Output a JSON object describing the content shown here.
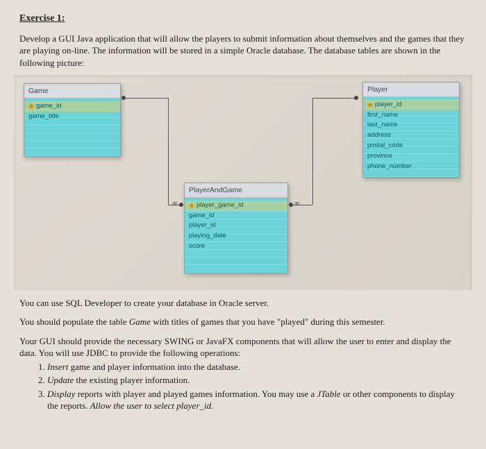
{
  "heading": "Exercise 1:",
  "intro": "Develop a GUI Java application that will allow the players to submit information about themselves and the games that they are playing on-line. The information will be stored in a simple Oracle database. The database tables are shown in the following picture:",
  "tables": {
    "game": {
      "name": "Game",
      "fields": [
        "game_id",
        "game_title"
      ]
    },
    "player": {
      "name": "Player",
      "fields": [
        "player_id",
        "first_name",
        "last_name",
        "address",
        "postal_code",
        "province",
        "phone_number"
      ]
    },
    "pag": {
      "name": "PlayerAndGame",
      "fields": [
        "player_game_id",
        "game_id",
        "player_id",
        "playing_date",
        "score"
      ]
    }
  },
  "p1": "You can use SQL Developer to create your database in Oracle server.",
  "p2_a": "You should populate the table ",
  "p2_game": "Game",
  "p2_b": " with titles of games that you have \"played\" during this semester.",
  "p3": "Your GUI should provide the necessary SWING or JavaFX components that will allow the user to enter and display the data. You will use JDBC to provide the following operations:",
  "ops": {
    "o1_a": "Insert",
    "o1_b": " game and player information into the database.",
    "o2_a": "Update",
    "o2_b": " the existing player information.",
    "o3_a": "Display",
    "o3_b": " reports with player and played games information. You may use a ",
    "o3_c": "JTable",
    "o3_d": " or other components to display the reports. ",
    "o3_e": "Allow the user to select player_id."
  }
}
